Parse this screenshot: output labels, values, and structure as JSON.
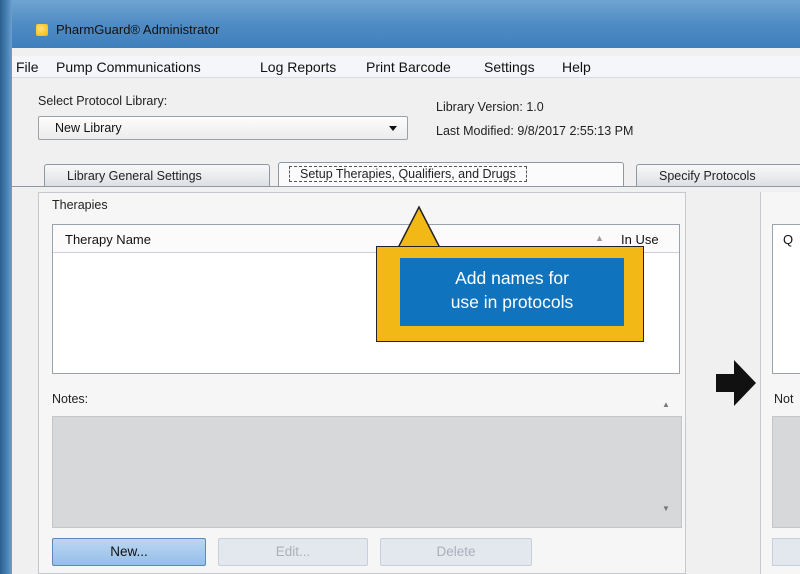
{
  "window": {
    "title": "PharmGuard® Administrator"
  },
  "menu": [
    "File",
    "Pump Communications",
    "Log Reports",
    "Print Barcode",
    "Settings",
    "Help"
  ],
  "library": {
    "select_label": "Select Protocol Library:",
    "selected": "New Library",
    "version_label": "Library Version:",
    "version": "1.0",
    "modified_label": "Last Modified:",
    "modified": "9/8/2017 2:55:13 PM"
  },
  "tabs": [
    "Library General Settings",
    "Setup Therapies, Qualifiers, and Drugs",
    "Specify Protocols"
  ],
  "therapies": {
    "group_label": "Therapies",
    "col_name": "Therapy Name",
    "col_inuse": "In Use",
    "notes_label": "Notes:"
  },
  "buttons": {
    "new": "New...",
    "edit": "Edit...",
    "delete": "Delete"
  },
  "right_panel": {
    "col_partial": "Q",
    "notes_partial": "Not"
  },
  "callout": {
    "line1": "Add names for",
    "line2": "use in protocols"
  },
  "colors": {
    "callout_fill": "#f2b916",
    "callout_text_bg": "#0f73be"
  }
}
